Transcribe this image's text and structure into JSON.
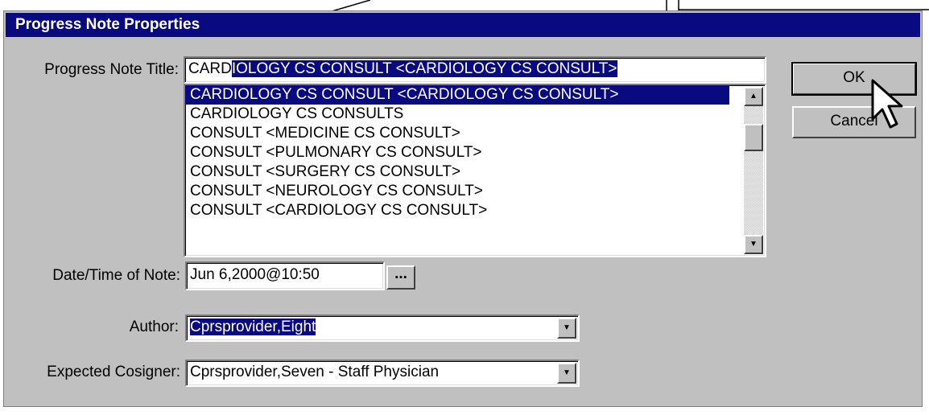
{
  "window": {
    "title": "Progress Note Properties"
  },
  "title_field": {
    "label": "Progress Note Title:",
    "typed": "CARD",
    "autocomplete": "IOLOGY CS CONSULT  <CARDIOLOGY CS CONSULT>"
  },
  "title_list": {
    "items": [
      "CARDIOLOGY CS CONSULT  <CARDIOLOGY CS CONSULT>",
      "CARDIOLOGY CS CONSULTS",
      "CONSULT  <MEDICINE CS CONSULT>",
      "CONSULT  <PULMONARY CS CONSULT>",
      "CONSULT  <SURGERY CS CONSULT>",
      "CONSULT  <NEUROLOGY CS CONSULT>",
      "CONSULT  <CARDIOLOGY CS CONSULT>"
    ],
    "selected_index": 0
  },
  "date_field": {
    "label": "Date/Time of Note:",
    "value": "Jun 6,2000@10:50",
    "button_label": "..."
  },
  "author": {
    "label": "Author:",
    "value": "Cprsprovider,Eight"
  },
  "cosigner": {
    "label": "Expected Cosigner:",
    "value": "Cprsprovider,Seven - Staff Physician"
  },
  "buttons": {
    "ok": "OK",
    "cancel": "Cancel"
  },
  "glyphs": {
    "scroll_up": "▲",
    "scroll_down": "▼",
    "dropdown": "▼"
  },
  "colors": {
    "title_bar": "#0a0a80",
    "dialog_bg": "#c0c0c0",
    "selection": "#0a0a80"
  }
}
